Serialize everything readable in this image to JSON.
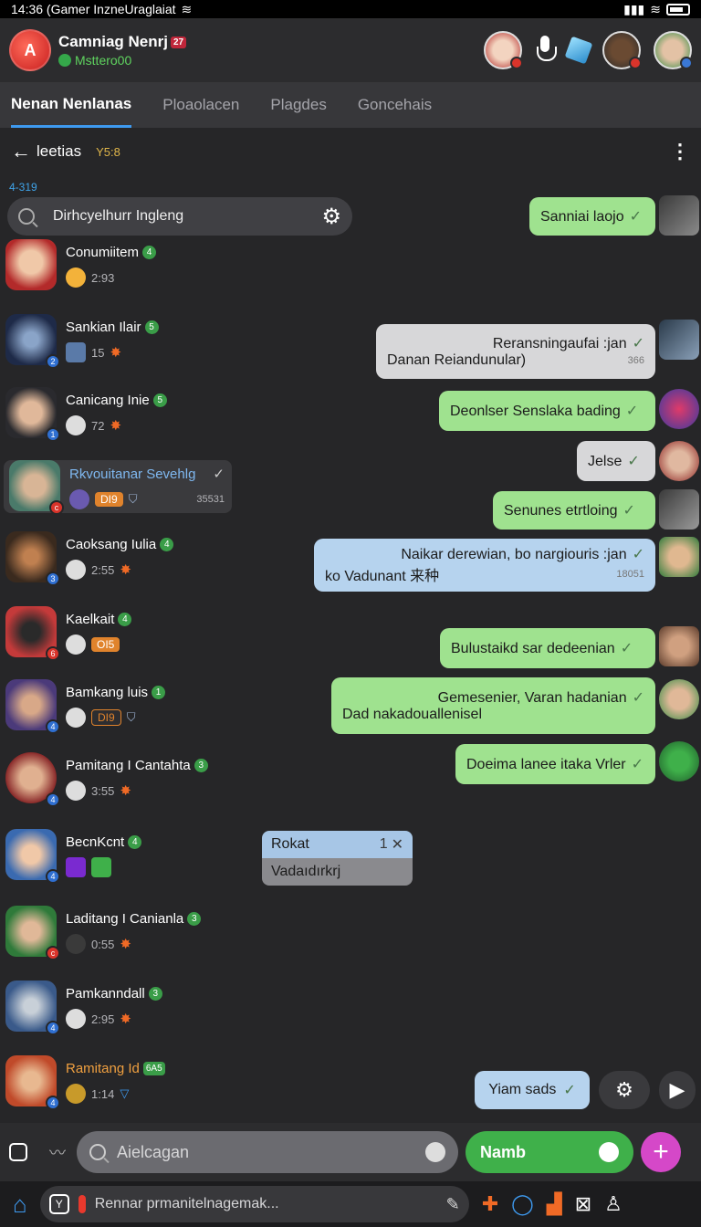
{
  "status": {
    "left_text": "14:36 (Gamer InzneUraglaiat"
  },
  "header": {
    "title": "Camniag Nenrj",
    "title_badge": "27",
    "subtitle": "Msttero00",
    "logo_text": "A"
  },
  "tabs": [
    "Nenan Nenlanas",
    "Ploaolacen",
    "Plagdes",
    "Goncehais"
  ],
  "subheader": {
    "back_label": "leetias",
    "tag": "Y5:8",
    "mini_label": "4-319"
  },
  "search": {
    "value": "Dirhcyelhurr Ingleng"
  },
  "contacts": [
    {
      "name": "Conumiitem",
      "num": "4",
      "meta": "2:93",
      "badge": "",
      "color": "#b32a2a"
    },
    {
      "name": "Sankian Ilair",
      "num": "5",
      "meta": "15",
      "badge": "",
      "color": "#2b3e6e"
    },
    {
      "name": "Canicang Inie",
      "num": "5",
      "meta": "72",
      "badge": "",
      "color": "#3c3c40"
    },
    {
      "name": "Rkvouitanar Sevehlg",
      "num": "",
      "meta": "35531",
      "badge": "DI9",
      "color": "#5c8a7a"
    },
    {
      "name": "Caoksang Iulia",
      "num": "4",
      "meta": "2:55",
      "badge": "",
      "color": "#6b4a2a"
    },
    {
      "name": "Kaelkait",
      "num": "4",
      "meta": "",
      "badge": "OI5",
      "color": "#b83030"
    },
    {
      "name": "Bamkang luis",
      "num": "1",
      "meta": "",
      "badge": "DI9",
      "color": "#4b3a7a"
    },
    {
      "name": "Pamitang I Cantahta",
      "num": "3",
      "meta": "3:55",
      "badge": "",
      "color": "#8a2a2a"
    },
    {
      "name": "BecnKcnt",
      "num": "4",
      "meta": "",
      "badge": "",
      "color": "#3a6ab0"
    },
    {
      "name": "Laditang I Canianla",
      "num": "3",
      "meta": "0:55",
      "badge": "",
      "color": "#2f7a3a"
    },
    {
      "name": "Pamkanndall",
      "num": "3",
      "meta": "2:95",
      "badge": "",
      "color": "#3a5a8a"
    },
    {
      "name": "Ramitang Id",
      "num": "6A5",
      "meta": "1:14",
      "badge": "",
      "color": "#c04a2a"
    }
  ],
  "messages": [
    {
      "text": "Sanniai laojo",
      "text2": "",
      "stamp": "",
      "style": "green"
    },
    {
      "text": "Reransningaufai :jan",
      "text2": "Danan Reiandunular)",
      "stamp": "366",
      "style": "grey"
    },
    {
      "text": "Deonlser Senslaka bading",
      "text2": "",
      "stamp": "",
      "style": "green"
    },
    {
      "text": "Jelse",
      "text2": "",
      "stamp": "",
      "style": "grey"
    },
    {
      "text": "Senunes etrtloing",
      "text2": "",
      "stamp": "",
      "style": "green"
    },
    {
      "text": "Naikar derewian, bo nargiouris :jan",
      "text2": "ko Vadunant 来种",
      "stamp": "18051",
      "style": "blue"
    },
    {
      "text": "Bulustaikd sar dedeenian",
      "text2": "",
      "stamp": "",
      "style": "green"
    },
    {
      "text": "Gemesenier, Varan hadanian",
      "text2": "Dad nakadouallenisel",
      "stamp": "",
      "style": "green"
    },
    {
      "text": "Doeima lanee itaka Vrler",
      "text2": "",
      "stamp": "",
      "style": "green"
    }
  ],
  "rokat": {
    "title": "Rokat",
    "count": "1",
    "subtitle": "Vadaıdırkrj"
  },
  "floating": {
    "yiam_label": "Yiam sads"
  },
  "composer": {
    "placeholder": "Aielcagan",
    "send_label": "Namb"
  },
  "navbar": {
    "field_text": "Rennar prmanitelnagemak..."
  }
}
